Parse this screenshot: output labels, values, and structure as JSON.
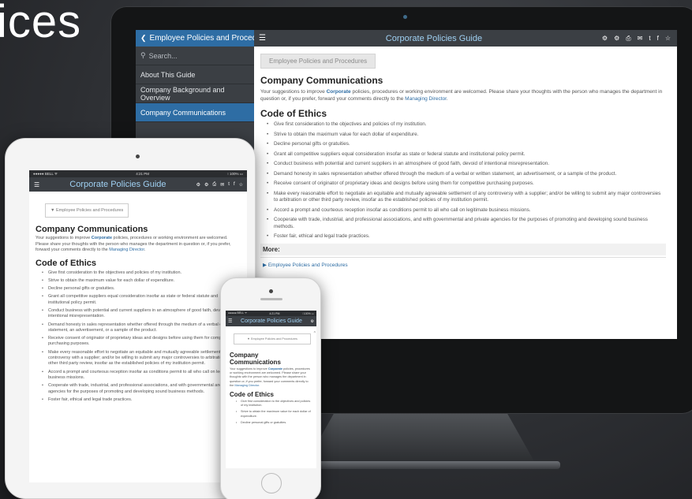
{
  "hero": {
    "text": "ices"
  },
  "app": {
    "title": "Corporate Policies Guide",
    "toolbar_icons": [
      "settings-icon",
      "settings-icon",
      "print-icon",
      "email-icon",
      "twitter-icon",
      "facebook-icon",
      "star-icon"
    ]
  },
  "desktop": {
    "sidebar": {
      "header": "Employee Policies and Proced...",
      "search_placeholder": "Search...",
      "items": [
        {
          "label": "About This Guide",
          "active": false
        },
        {
          "label": "Company Background and Overview",
          "active": false
        },
        {
          "label": "Company Communications",
          "active": true
        }
      ]
    },
    "breadcrumb": "Employee Policies and Procedures",
    "more_label": "More:",
    "more_link": "Employee Policies and Procedures"
  },
  "content": {
    "heading": "Company Communications",
    "intro_pre": "Your suggestions to improve ",
    "intro_highlight": "Corporate",
    "intro_mid": " policies, procedures or working environment are welcomed. Please share your thoughts with the person who manages the department in question or, if you prefer, forward your comments directly to the ",
    "intro_link": "Managing Director",
    "intro_end": ".",
    "ethics_heading": "Code of Ethics",
    "ethics": [
      "Give first consideration to the objectives and policies of my institution.",
      "Strive to obtain the maximum value for each dollar of expenditure.",
      "Decline personal gifts or gratuities.",
      "Grant all competitive suppliers equal consideration insofar as state or federal statute and institutional policy permit.",
      "Conduct business with potential and current suppliers in an atmosphere of good faith, devoid of intentional misrepresentation.",
      "Demand honesty in sales representation whether offered through the medium of a verbal or written statement, an advertisement, or a sample of the product.",
      "Receive consent of originator of proprietary ideas and designs before using them for competitive purchasing purposes.",
      "Make every reasonable effort to negotiate an equitable and mutually agreeable settlement of any controversy with a supplier; and/or be willing to submit any major controversies to arbitration or other third party review, insofar as the established policies of my institution permit.",
      "Accord a prompt and courteous reception insofar as conditions permit to all who call on legitimate business missions.",
      "Cooperate with trade, industrial, and professional associations, and with governmental and private agencies for the purposes of promoting and developing sound business methods.",
      "Foster fair, ethical and legal trade practices."
    ]
  },
  "tablet": {
    "status_left": "●●●●● BELL ᯤ",
    "status_time": "4:21 PM",
    "status_right": "⁝ 100% ▭",
    "breadcrumb": "Employee Policies and Procedures"
  },
  "phone": {
    "status_left": "●●●●● BELL ᯤ",
    "status_time": "4:21 PM",
    "status_right": "⁝ 100% ▭",
    "title": "Corporate Policies Guide",
    "breadcrumb": "Employee Policies and Procedures",
    "heading_line1": "Company",
    "heading_line2": "Communications"
  }
}
